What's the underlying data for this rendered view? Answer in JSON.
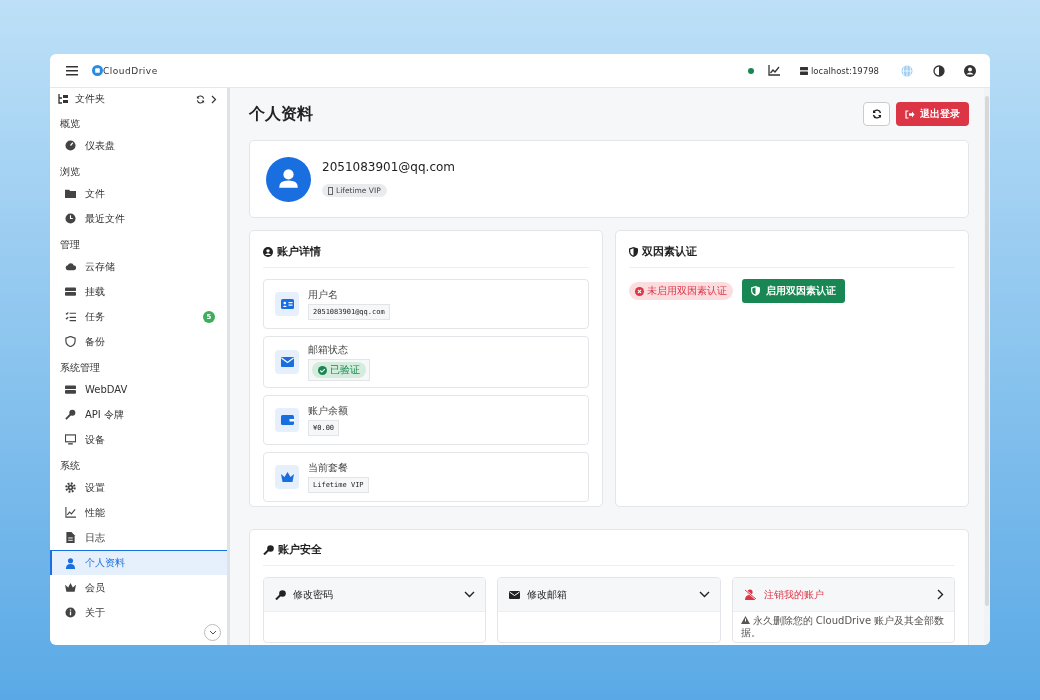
{
  "topbar": {
    "brand": "CloudDrive",
    "online": true,
    "host": "localhost:19798"
  },
  "sidebar": {
    "header": "文件夹",
    "sections": [
      {
        "title": "概览",
        "items": [
          {
            "label": "仪表盘",
            "selected": false
          }
        ]
      },
      {
        "title": "浏览",
        "items": [
          {
            "label": "文件",
            "selected": false
          },
          {
            "label": "最近文件",
            "selected": false
          }
        ]
      },
      {
        "title": "管理",
        "items": [
          {
            "label": "云存储",
            "selected": false
          },
          {
            "label": "挂载",
            "selected": false
          },
          {
            "label": "任务",
            "selected": false,
            "badge": "5"
          },
          {
            "label": "备份",
            "selected": false
          }
        ]
      },
      {
        "title": "系统管理",
        "items": [
          {
            "label": "WebDAV",
            "selected": false
          },
          {
            "label": "API 令牌",
            "selected": false
          },
          {
            "label": "设备",
            "selected": false
          }
        ]
      },
      {
        "title": "系统",
        "items": [
          {
            "label": "设置",
            "selected": false
          },
          {
            "label": "性能",
            "selected": false
          },
          {
            "label": "日志",
            "selected": false
          },
          {
            "label": "个人资料",
            "selected": true
          },
          {
            "label": "会员",
            "selected": false
          },
          {
            "label": "关于",
            "selected": false
          }
        ]
      }
    ]
  },
  "page": {
    "title": "个人资料",
    "logout": "退出登录"
  },
  "profile": {
    "email": "2051083901@qq.com",
    "plan": "Lifetime VIP"
  },
  "details": {
    "title": "账户详情",
    "rows": [
      {
        "label": "用户名",
        "kind": "text",
        "value": "2051083901@qq.com"
      },
      {
        "label": "邮箱状态",
        "kind": "badge",
        "value": "已验证"
      },
      {
        "label": "账户余额",
        "kind": "text",
        "value": "¥0.00"
      },
      {
        "label": "当前套餐",
        "kind": "text",
        "value": "Lifetime VIP"
      }
    ]
  },
  "two_factor": {
    "title": "双因素认证",
    "enabled": false,
    "status": "未启用双因素认证",
    "button": "启用双因素认证"
  },
  "security": {
    "title": "账户安全",
    "panels": [
      {
        "title": "修改密码",
        "kind": "collapse",
        "expanded": false
      },
      {
        "title": "修改邮箱",
        "kind": "collapse",
        "expanded": false
      },
      {
        "title": "注销我的账户",
        "kind": "danger",
        "note": "永久删除您的 CloudDrive 账户及其全部数据。"
      }
    ]
  }
}
